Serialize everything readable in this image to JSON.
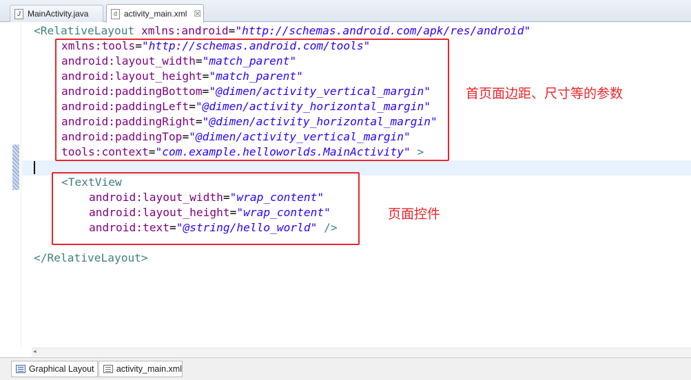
{
  "tabs": {
    "java_tab": {
      "label": "MainActivity.java",
      "icon": "java-file-icon"
    },
    "xml_tab": {
      "label": "activity_main.xml",
      "icon": "xml-file-icon",
      "close": "☒"
    }
  },
  "code": {
    "l1_open": "<",
    "l1_tag": "RelativeLayout",
    "l1_attr": "xmlns:android",
    "l1_val": "\"http://schemas.android.com/apk/res/android\"",
    "l2_attr": "xmlns:tools",
    "l2_val": "\"http://schemas.android.com/tools\"",
    "l3_attr": "android:layout_width",
    "l3_val": "\"match_parent\"",
    "l4_attr": "android:layout_height",
    "l4_val": "\"match_parent\"",
    "l5_attr": "android:paddingBottom",
    "l5_val": "\"@dimen/activity_vertical_margin\"",
    "l6_attr": "android:paddingLeft",
    "l6_val": "\"@dimen/activity_horizontal_margin\"",
    "l7_attr": "android:paddingRight",
    "l7_val": "\"@dimen/activity_horizontal_margin\"",
    "l8_attr": "android:paddingTop",
    "l8_val": "\"@dimen/activity_vertical_margin\"",
    "l9_attr": "tools:context",
    "l9_val": "\"com.example.helloworlds.MainActivity\"",
    "l9_close": " >",
    "l10_open": "<",
    "l10_tag": "TextView",
    "l11_attr": "android:layout_width",
    "l11_val": "\"wrap_content\"",
    "l12_attr": "android:layout_height",
    "l12_val": "\"wrap_content\"",
    "l13_attr": "android:text",
    "l13_val": "\"@string/hello_world\"",
    "l13_close": " />",
    "l14_close": "</RelativeLayout>",
    "eq": "="
  },
  "annotations": {
    "note_1": "首页面边距、尺寸等的参数",
    "note_2": "页面控件"
  },
  "bottom_tabs": {
    "graphical": "Graphical Layout",
    "source": "activity_main.xml"
  },
  "scroll": {
    "left_arrow": "◂"
  },
  "colors": {
    "annotation_red": "#e8252a",
    "tag": "#3f7f7f",
    "attribute": "#7f007f",
    "value": "#2a00ff",
    "current_line": "#e8f2fe"
  }
}
